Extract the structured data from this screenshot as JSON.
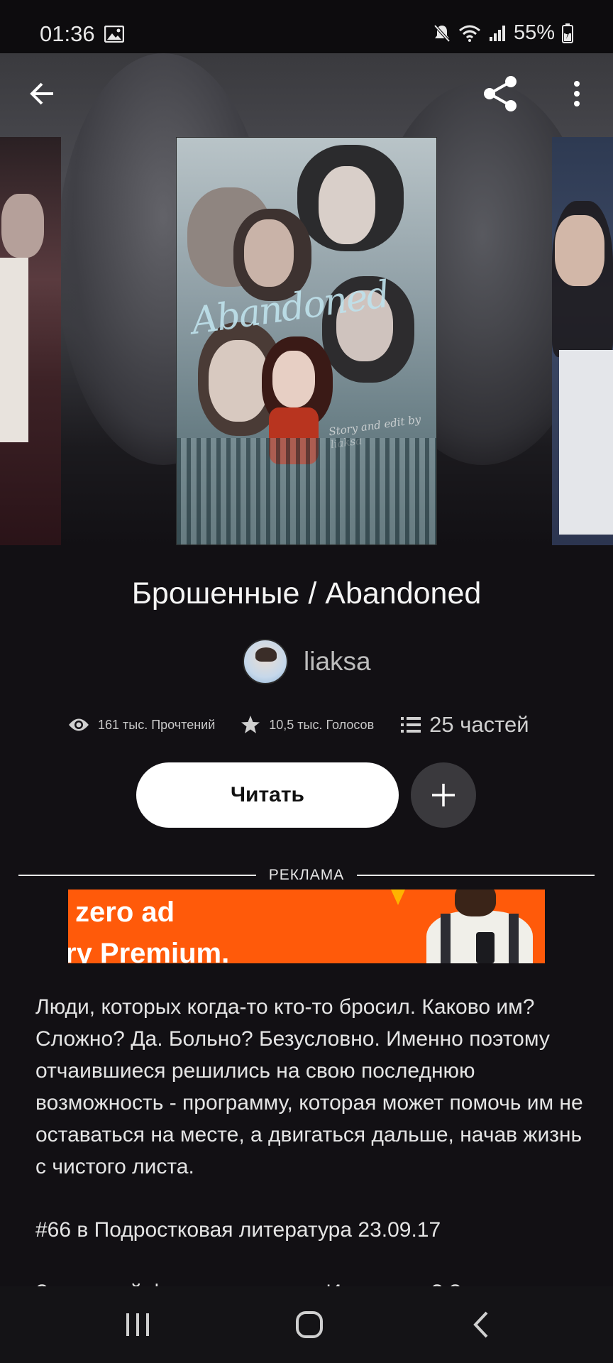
{
  "status_bar": {
    "time": "01:36",
    "battery": "55%",
    "icons": [
      "gallery-icon",
      "mute-icon",
      "wifi-icon",
      "signal-icon",
      "battery-icon"
    ]
  },
  "top_bar": {
    "icons": [
      "back-arrow-icon",
      "share-icon",
      "more-vert-icon"
    ]
  },
  "story": {
    "title": "Брошенные / Abandoned",
    "author": "liaksa",
    "cover_text": "Abandoned",
    "cover_signature": "Story and edit by liaksa",
    "stats": {
      "reads": "161 тыс. Прочтений",
      "votes": "10,5 тыс. Голосов",
      "parts": "25 частей"
    },
    "read_button": "Читать",
    "add_button_icon": "plus-icon"
  },
  "ad": {
    "label": "РЕКЛАМА",
    "line1": "zero ad",
    "line2": "ry Premium.",
    "bg_color": "#ff5a0a"
  },
  "description": {
    "text": "Люди, которых когда-то кто-то бросил. Каково им? Сложно? Да. Больно? Безусловно. Именно поэтому отчаившиеся решились на свою последнюю возможность - программу, которая может помочь им не оставаться на месте, а двигаться дальше, начав жизнь с чистого листа.",
    "rank": "#66 в Подростковая литература 23.09.17",
    "cut_line": "Заглавный фото по канале в Инстаграм? Заходи"
  },
  "nav_bar": {
    "icons": [
      "recents-icon",
      "home-icon",
      "back-icon"
    ]
  }
}
